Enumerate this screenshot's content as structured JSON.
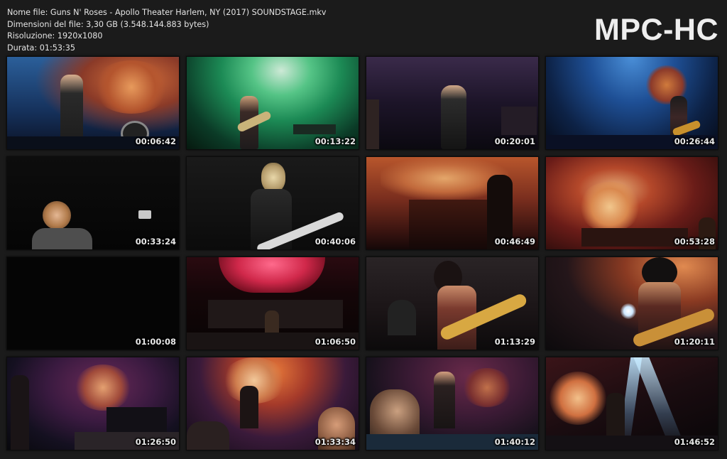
{
  "info": {
    "filename": "Nome file: Guns N' Roses - Apollo Theater Harlem, NY (2017) SOUNDSTAGE.mkv",
    "filesize": "Dimensioni del file: 3,30 GB (3.548.144.883 bytes)",
    "resolution": "Risoluzione: 1920x1080",
    "duration": "Durata: 01:53:35"
  },
  "logo": "MPC-HC",
  "thumbnails": [
    {
      "time": "00:06:42"
    },
    {
      "time": "00:13:22"
    },
    {
      "time": "00:20:01"
    },
    {
      "time": "00:26:44"
    },
    {
      "time": "00:33:24"
    },
    {
      "time": "00:40:06"
    },
    {
      "time": "00:46:49"
    },
    {
      "time": "00:53:28"
    },
    {
      "time": "01:00:08"
    },
    {
      "time": "01:06:50"
    },
    {
      "time": "01:13:29"
    },
    {
      "time": "01:20:11"
    },
    {
      "time": "01:26:50"
    },
    {
      "time": "01:33:34"
    },
    {
      "time": "01:40:12"
    },
    {
      "time": "01:46:52"
    }
  ]
}
